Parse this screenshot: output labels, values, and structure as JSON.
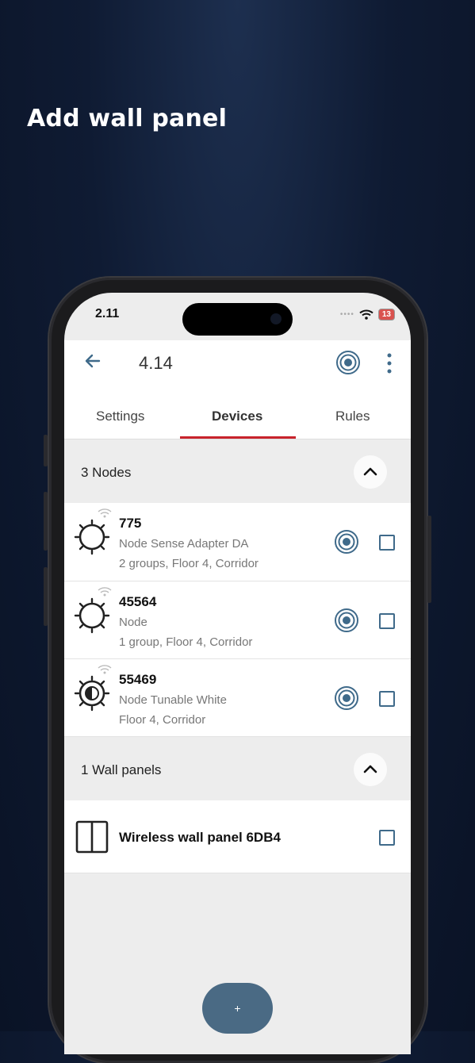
{
  "headline": "Add wall panel",
  "status": {
    "time": "2.11",
    "battery": "13"
  },
  "appbar": {
    "title": "4.14"
  },
  "tabs": [
    {
      "label": "Settings",
      "active": false
    },
    {
      "label": "Devices",
      "active": true
    },
    {
      "label": "Rules",
      "active": false
    }
  ],
  "nodes_section": {
    "label": "3 Nodes"
  },
  "nodes": [
    {
      "name": "775",
      "type": "Node Sense Adapter DA",
      "location": "2 groups, Floor 4, Corridor"
    },
    {
      "name": "45564",
      "type": "Node",
      "location": "1 group, Floor 4, Corridor"
    },
    {
      "name": "55469",
      "type": "Node Tunable White",
      "location": "Floor 4, Corridor"
    }
  ],
  "wall_section": {
    "label": "1 Wall panels"
  },
  "wall_panels": [
    {
      "name": "Wireless wall panel 6DB4"
    }
  ],
  "fab": {
    "label": "+"
  },
  "colors": {
    "accent": "#3f6a8a",
    "tab_indicator": "#c8232c",
    "fab": "#4a6a84"
  },
  "icons": {
    "back": "arrow-left-icon",
    "identify": "target-icon",
    "more": "more-vertical-icon",
    "collapse": "chevron-up-icon",
    "node": "sun-icon",
    "tunable": "half-sun-icon",
    "signal": "wifi-icon",
    "wall_panel": "wall-panel-icon"
  }
}
